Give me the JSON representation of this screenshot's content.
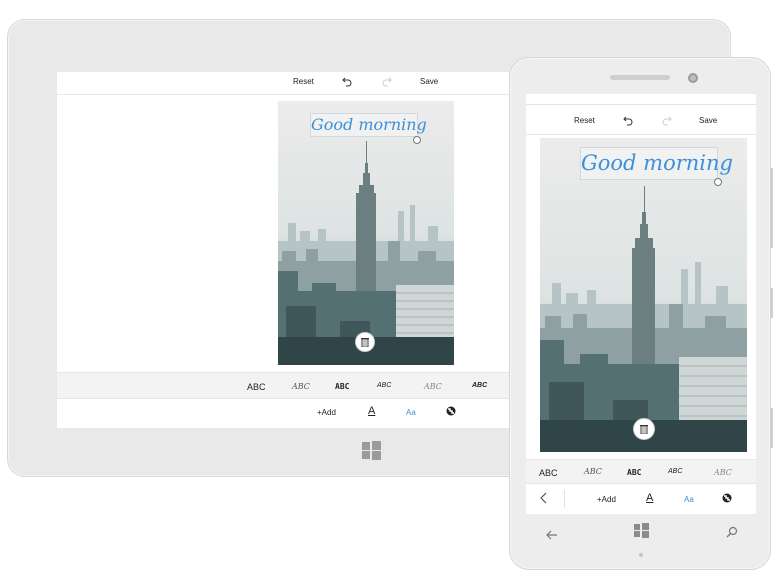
{
  "toolbar": {
    "reset": "Reset",
    "save": "Save"
  },
  "caption": {
    "text": "Good morning"
  },
  "font_samples_tablet": [
    "ABC",
    "ABC",
    "ABC",
    "ABC",
    "ABC",
    "ABC"
  ],
  "font_samples_phone": [
    "ABC",
    "ABC",
    "ABC",
    "ABC",
    "ABC"
  ],
  "bottom": {
    "add": "+Add",
    "text_color": "A",
    "font": "Aa"
  },
  "colors": {
    "accent": "#3d8fd8",
    "caption": "#3d8fd8"
  },
  "icons": [
    "undo-icon",
    "redo-icon",
    "trash-icon",
    "opacity-icon",
    "windows-logo",
    "back-arrow-icon",
    "search-icon",
    "chevron-left-icon"
  ]
}
